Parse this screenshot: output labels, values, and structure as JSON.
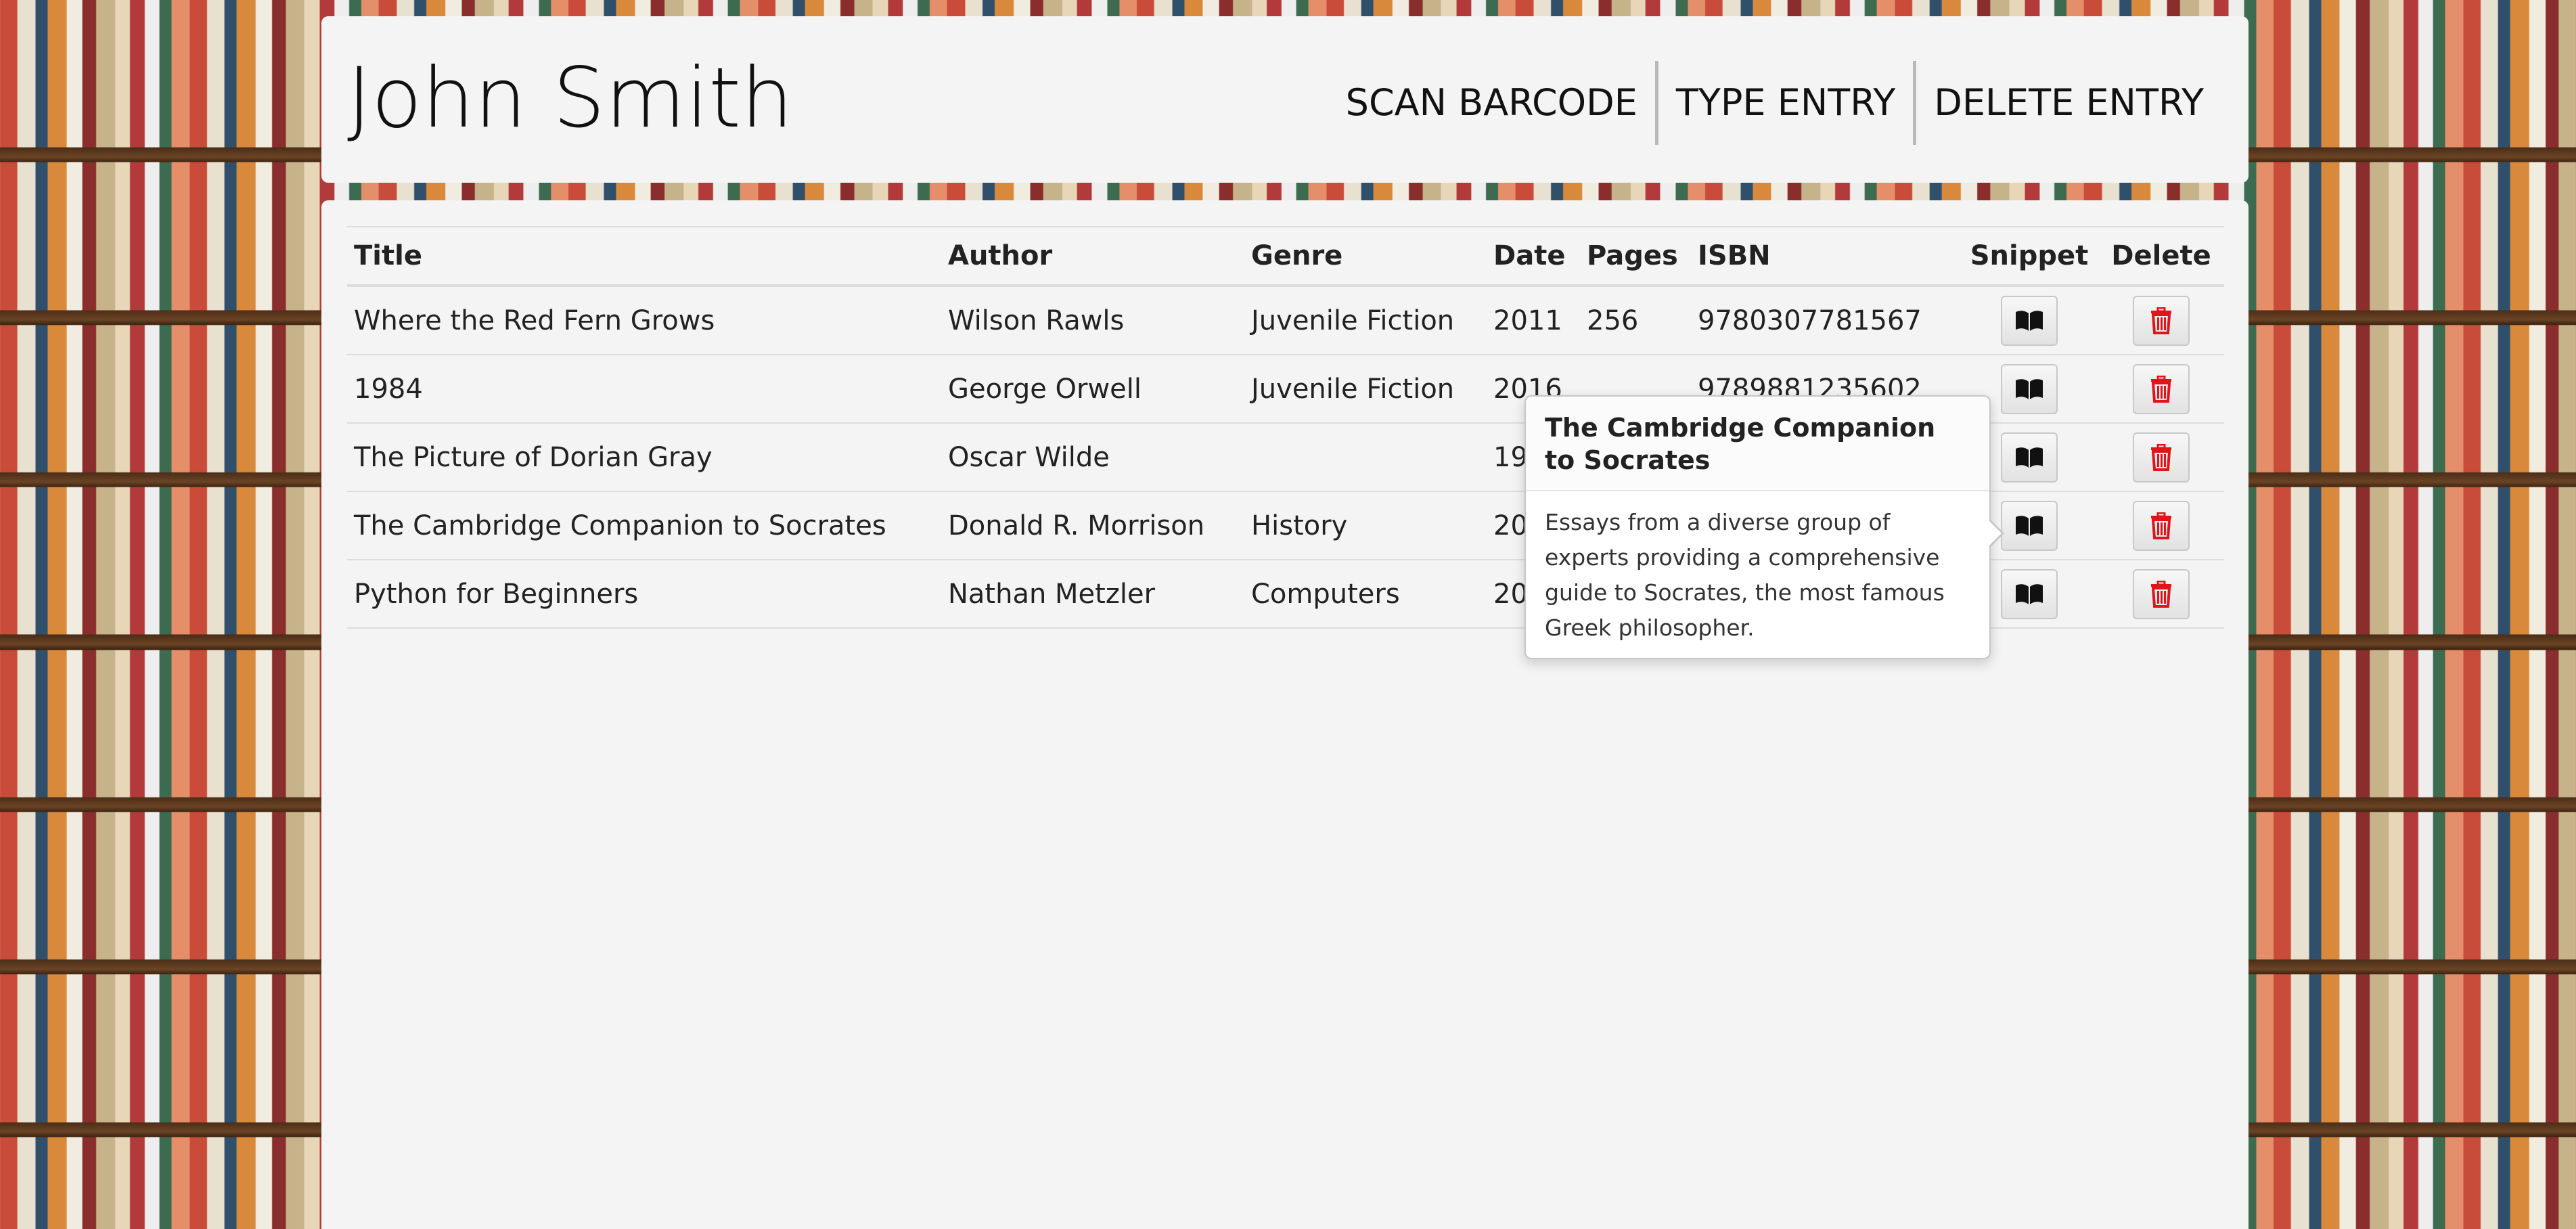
{
  "header": {
    "user_name": "John Smith",
    "nav": [
      "SCAN BARCODE",
      "TYPE ENTRY",
      "DELETE ENTRY"
    ]
  },
  "table": {
    "columns": [
      "Title",
      "Author",
      "Genre",
      "Date",
      "Pages",
      "ISBN",
      "Snippet",
      "Delete"
    ],
    "rows": [
      {
        "title": "Where the Red Fern Grows",
        "author": "Wilson Rawls",
        "genre": "Juvenile Fiction",
        "date": "2011",
        "pages": "256",
        "isbn": "9780307781567"
      },
      {
        "title": "1984",
        "author": "George Orwell",
        "genre": "Juvenile Fiction",
        "date": "2016",
        "pages": "",
        "isbn": "9789881235602"
      },
      {
        "title": "The Picture of Dorian Gray",
        "author": "Oscar Wilde",
        "genre": "",
        "date": "19",
        "pages": "",
        "isbn": ""
      },
      {
        "title": "The Cambridge Companion to Socrates",
        "author": "Donald R. Morrison",
        "genre": "History",
        "date": "20",
        "pages": "",
        "isbn": ""
      },
      {
        "title": "Python for Beginners",
        "author": "Nathan Metzler",
        "genre": "Computers",
        "date": "20",
        "pages": "",
        "isbn": ""
      }
    ]
  },
  "popover": {
    "title": "The Cambridge Companion to Socrates",
    "body": "Essays from a diverse group of experts providing a comprehensive guide to Socrates, the most famous Greek philosopher."
  },
  "colors": {
    "delete_icon": "#e0141b",
    "panel": "#f4f4f4"
  }
}
